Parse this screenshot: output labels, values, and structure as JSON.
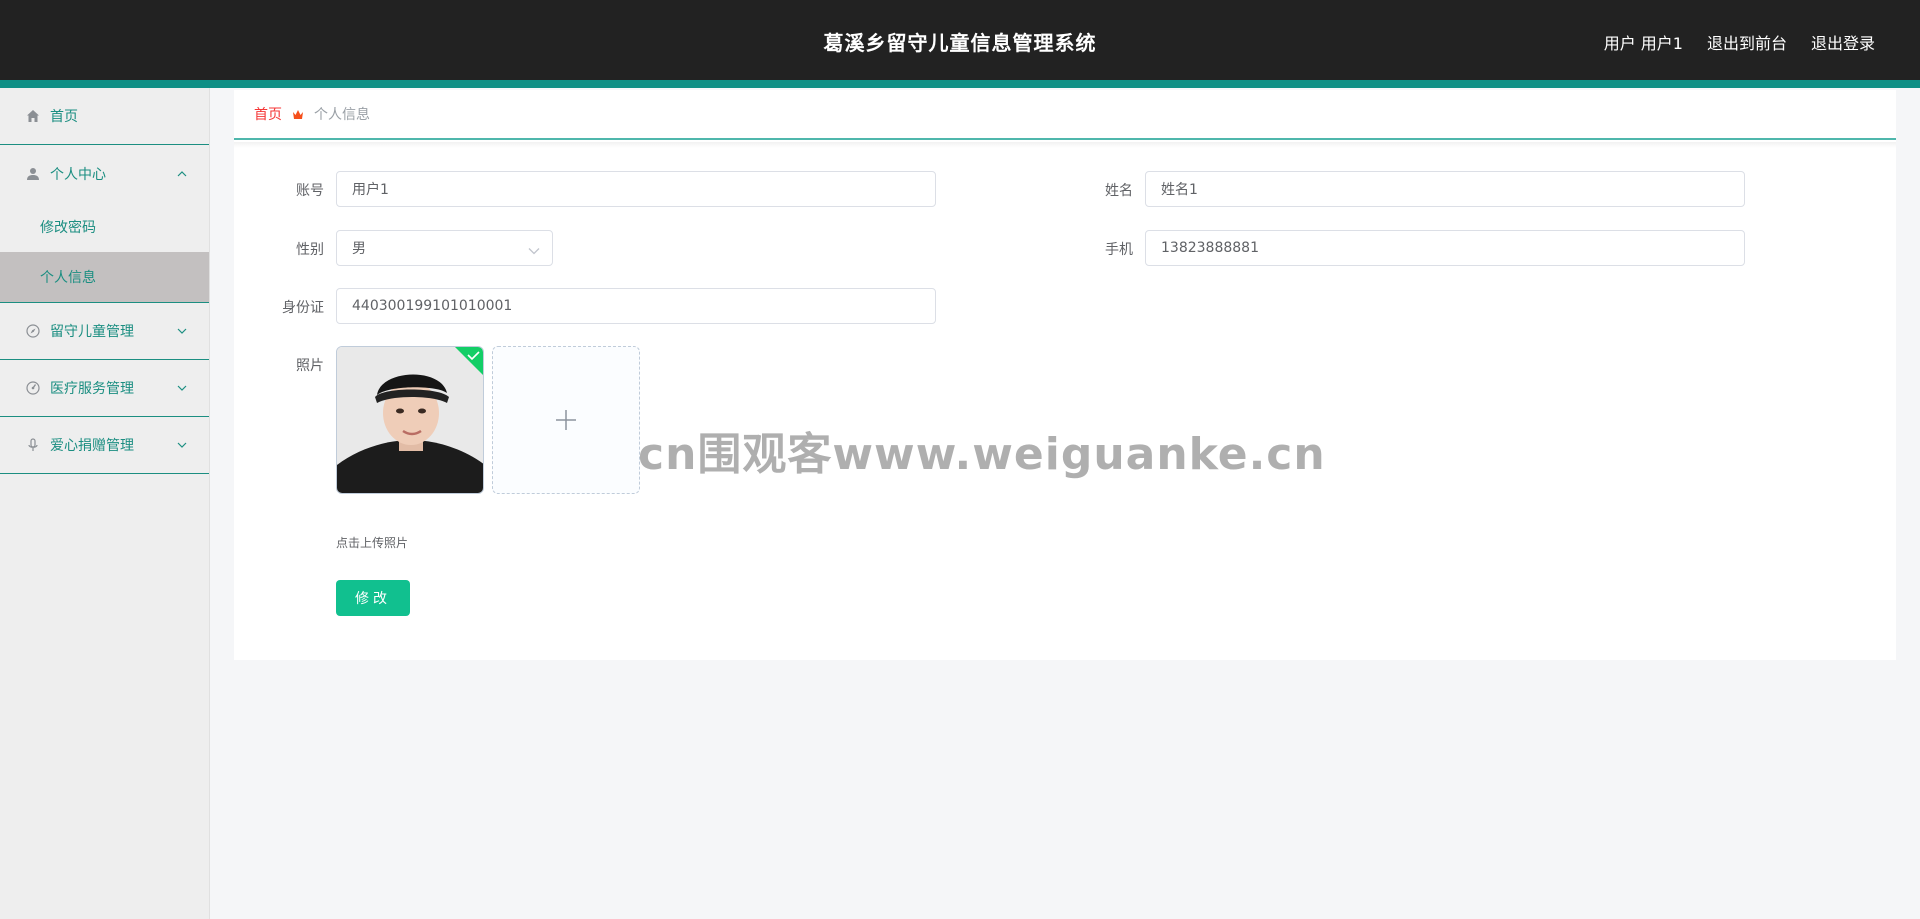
{
  "header": {
    "title": "葛溪乡留守儿童信息管理系统",
    "user_label": "用户 用户1",
    "to_frontend": "退出到前台",
    "logout": "退出登录"
  },
  "sidebar": {
    "home": "首页",
    "personal_center": "个人中心",
    "change_password": "修改密码",
    "personal_info": "个人信息",
    "children_mgmt": "留守儿童管理",
    "medical_mgmt": "医疗服务管理",
    "donation_mgmt": "爱心捐赠管理"
  },
  "breadcrumb": {
    "home": "首页",
    "current": "个人信息"
  },
  "form": {
    "account_label": "账号",
    "account_value": "用户1",
    "name_label": "姓名",
    "name_value": "姓名1",
    "gender_label": "性别",
    "gender_value": "男",
    "phone_label": "手机",
    "phone_value": "13823888881",
    "id_label": "身份证",
    "id_value": "440300199101010001",
    "photo_label": "照片",
    "upload_tip": "点击上传照片",
    "submit": "修改"
  },
  "watermark": "cn围观客www.weiguanke.cn",
  "colors": {
    "topbar": "#222222",
    "accent": "#0f8f85",
    "menu_text": "#1b8e81",
    "button": "#11c08f",
    "breadcrumb_home": "#f53636"
  }
}
